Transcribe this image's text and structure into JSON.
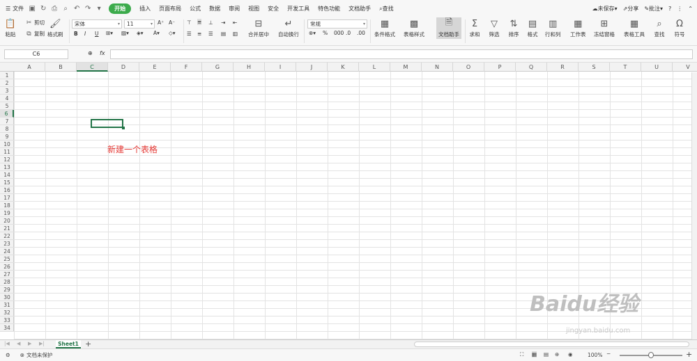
{
  "menubar": {
    "file": "文件",
    "tabs": [
      "开始",
      "插入",
      "页面布局",
      "公式",
      "数据",
      "审阅",
      "视图",
      "安全",
      "开发工具",
      "特色功能",
      "文档助手"
    ],
    "search": "查找",
    "unsaved": "未保存",
    "share": "分享",
    "comment": "批注"
  },
  "ribbon": {
    "paste": "粘贴",
    "cut": "剪切",
    "copy": "复制",
    "format_painter": "格式刷",
    "font": "宋体",
    "size": "11",
    "merge": "合并居中",
    "wrap": "自动换行",
    "numfmt": "常规",
    "cond_fmt": "条件格式",
    "table_style": "表格样式",
    "doc_helper": "文档助手",
    "sum": "求和",
    "filter": "筛选",
    "sort": "排序",
    "format": "格式",
    "rowcol": "行和列",
    "worksheet": "工作表",
    "freeze": "冻结窗格",
    "table_tools": "表格工具",
    "find": "查找",
    "symbol": "符号",
    "bold": "B",
    "italic": "I",
    "underline": "U"
  },
  "formula": {
    "cell": "C6",
    "fx": "fx",
    "value": ""
  },
  "columns": [
    "A",
    "B",
    "C",
    "D",
    "E",
    "F",
    "G",
    "H",
    "I",
    "J",
    "K",
    "L",
    "M",
    "N",
    "O",
    "P",
    "Q",
    "R",
    "S",
    "T",
    "U",
    "V"
  ],
  "rows": [
    "1",
    "2",
    "3",
    "4",
    "5",
    "6",
    "7",
    "8",
    "9",
    "10",
    "11",
    "12",
    "13",
    "14",
    "15",
    "16",
    "17",
    "18",
    "19",
    "20",
    "21",
    "22",
    "23",
    "24",
    "25",
    "26",
    "27",
    "28",
    "29",
    "30",
    "31",
    "32",
    "33",
    "34"
  ],
  "selected": {
    "column": "C",
    "row": "6"
  },
  "note": "新建一个表格",
  "sheet": {
    "name": "Sheet1",
    "add": "+"
  },
  "status": {
    "protect": "文档未保护",
    "zoom": "100%"
  },
  "watermark": {
    "brand": "Baidu经验",
    "url": "jingyan.baidu.com"
  },
  "colors": {
    "accent": "#3cab4c",
    "grid_select": "#217346",
    "note": "#e53935"
  }
}
